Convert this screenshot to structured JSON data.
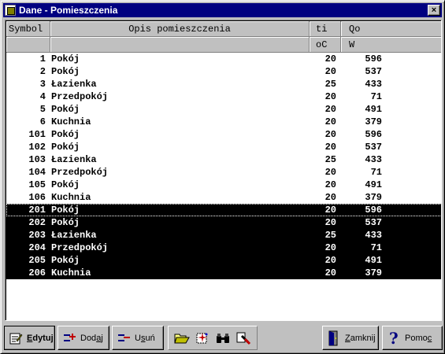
{
  "window": {
    "title": "Dane - Pomieszczenia",
    "close_label": "×"
  },
  "table": {
    "headers_top": {
      "symbol": "Symbol",
      "opis": "Opis pomieszczenia",
      "ti": "ti",
      "qo": "Qo"
    },
    "headers_units": {
      "symbol": "",
      "opis": "",
      "ti": "oC",
      "qo": "W"
    },
    "rows": [
      {
        "symbol": "1",
        "opis": "Pokój",
        "ti": "20",
        "qo": "596"
      },
      {
        "symbol": "2",
        "opis": "Pokój",
        "ti": "20",
        "qo": "537"
      },
      {
        "symbol": "3",
        "opis": "Łazienka",
        "ti": "25",
        "qo": "433"
      },
      {
        "symbol": "4",
        "opis": "Przedpokój",
        "ti": "20",
        "qo": "71"
      },
      {
        "symbol": "5",
        "opis": "Pokój",
        "ti": "20",
        "qo": "491"
      },
      {
        "symbol": "6",
        "opis": "Kuchnia",
        "ti": "20",
        "qo": "379"
      },
      {
        "symbol": "101",
        "opis": "Pokój",
        "ti": "20",
        "qo": "596"
      },
      {
        "symbol": "102",
        "opis": "Pokój",
        "ti": "20",
        "qo": "537"
      },
      {
        "symbol": "103",
        "opis": "Łazienka",
        "ti": "25",
        "qo": "433"
      },
      {
        "symbol": "104",
        "opis": "Przedpokój",
        "ti": "20",
        "qo": "71"
      },
      {
        "symbol": "105",
        "opis": "Pokój",
        "ti": "20",
        "qo": "491"
      },
      {
        "symbol": "106",
        "opis": "Kuchnia",
        "ti": "20",
        "qo": "379"
      },
      {
        "symbol": "201",
        "opis": "Pokój",
        "ti": "20",
        "qo": "596",
        "selected": true,
        "focused": true
      },
      {
        "symbol": "202",
        "opis": "Pokój",
        "ti": "20",
        "qo": "537",
        "selected": true
      },
      {
        "symbol": "203",
        "opis": "Łazienka",
        "ti": "25",
        "qo": "433",
        "selected": true
      },
      {
        "symbol": "204",
        "opis": "Przedpokój",
        "ti": "20",
        "qo": "71",
        "selected": true
      },
      {
        "symbol": "205",
        "opis": "Pokój",
        "ti": "20",
        "qo": "491",
        "selected": true
      },
      {
        "symbol": "206",
        "opis": "Kuchnia",
        "ti": "20",
        "qo": "379",
        "selected": true
      }
    ]
  },
  "toolbar": {
    "edit": {
      "pre": "",
      "key": "E",
      "post": "dytuj"
    },
    "add": {
      "pre": "Dod",
      "key": "a",
      "post": "j"
    },
    "delete": {
      "pre": "U",
      "key": "s",
      "post": "uń"
    },
    "close": {
      "pre": "",
      "key": "Z",
      "post": "amknij"
    },
    "help": {
      "pre": "Pomo",
      "key": "c",
      "post": ""
    }
  },
  "colors": {
    "titlebar": "#000080",
    "face": "#c0c0c0",
    "selection": "#000000"
  }
}
